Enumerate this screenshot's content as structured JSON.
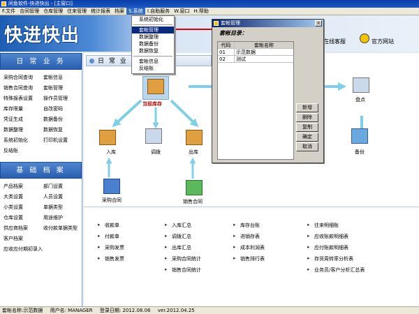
{
  "window": {
    "title": "闲鱼软件-快进快出 - [主窗口]"
  },
  "menu": [
    {
      "label": "F.文件"
    },
    {
      "label": "合同管理"
    },
    {
      "label": "仓库管理"
    },
    {
      "label": "往来管理"
    },
    {
      "label": "统计报表"
    },
    {
      "label": "档案"
    },
    {
      "label": "S.系统"
    },
    {
      "label": "I.自助服务"
    },
    {
      "label": "W.窗口"
    },
    {
      "label": "H.帮助"
    }
  ],
  "banner": {
    "logo": "快进快出",
    "links": [
      {
        "label": "在线客服"
      },
      {
        "label": "官方网站"
      }
    ]
  },
  "dropdown": {
    "items": [
      {
        "label": "系统初始化"
      },
      {
        "label": "套帐管理"
      },
      {
        "label": "数据整理"
      },
      {
        "label": "数据备份"
      },
      {
        "label": "数据恢复"
      },
      {
        "label": "套帐信息"
      },
      {
        "label": "反结账"
      }
    ]
  },
  "left": {
    "daily": {
      "title": "日 常 业 务",
      "items": [
        "采购合同查询",
        "套帐信息",
        "销售合同查询",
        "套帐管理",
        "特殊报表设置",
        "操作员管理",
        "库存限量",
        "自改密码",
        "凭证生成",
        "数据备份",
        "数据整理",
        "数据恢复",
        "系统初始化",
        "打印机设置",
        "反结账"
      ]
    },
    "basic": {
      "title": "基 础 档 案",
      "items": [
        "产品档案",
        "部门设置",
        "大类设置",
        "人员设置",
        "小类设置",
        "单据类型",
        "仓库设置",
        "用途维护",
        "供应商档案",
        "收付款单据类型",
        "客户档案",
        "",
        "应收应付期初录入"
      ]
    }
  },
  "main": {
    "header": "日 常 业",
    "flow": {
      "inventory": "当前库存",
      "check": "盘点",
      "inbound": "入库",
      "transfer": "调拨",
      "outbound": "出库",
      "backup": "备份",
      "purchase": "采购合同",
      "sales": "销售合同"
    },
    "reports": [
      [
        "收款单",
        "入库汇总",
        "库存台账",
        "往来明细账"
      ],
      [
        "付款单",
        "调拨汇总",
        "进销存表",
        "应收账款明细表"
      ],
      [
        "采购发票",
        "出库汇总",
        "成本利润表",
        "应付账款明细表"
      ],
      [
        "销售发票",
        "采购合同统计",
        "销售排行表",
        "存货周转率分析表"
      ],
      [
        "",
        "销售合同统计",
        "",
        "业务员/客户分析汇总表"
      ]
    ]
  },
  "dialog": {
    "title": "套帐管理",
    "subtitle": "套帐目录：",
    "columns": {
      "code": "代码",
      "name": "套帐名称"
    },
    "rows": [
      {
        "code": "01",
        "name": "示范数据"
      },
      {
        "code": "02",
        "name": "测试"
      }
    ],
    "buttons": [
      "新增",
      "删除",
      "复制",
      "确定",
      "取消"
    ],
    "close": "×"
  },
  "status": {
    "account": "套帐名称:示范数据",
    "user": "用户名: MANAGER",
    "login": "登录日期: 2012.08.06",
    "version": "ver.2012.04.25"
  },
  "colors": {
    "accent": "#316ac5",
    "banner": "#1d5db3",
    "arrow": "#e00000"
  }
}
